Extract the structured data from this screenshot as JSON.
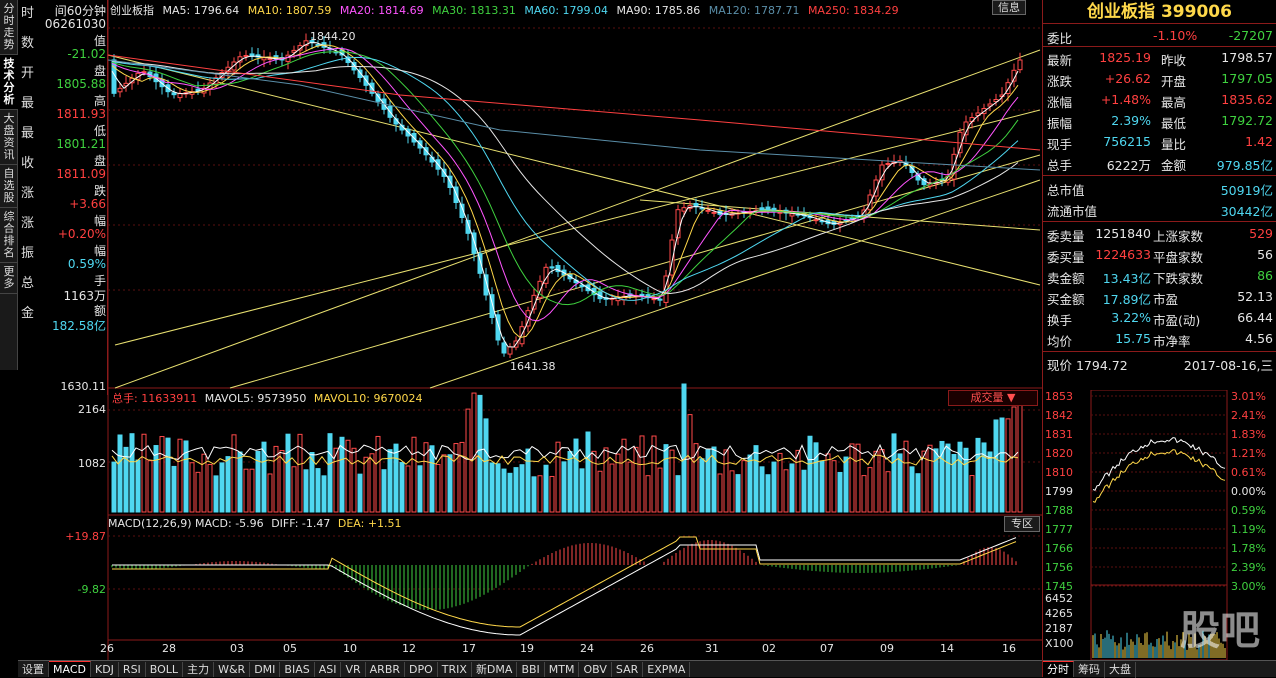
{
  "vertical_tabs": [
    "分时走势",
    "技术分析",
    "大盘资讯",
    "自选股",
    "综合排名",
    "更多"
  ],
  "left_info": {
    "items": [
      {
        "label": "时",
        "value": "间60分钟",
        "color": "white"
      },
      {
        "label": "",
        "value": "06261030",
        "color": "white"
      },
      {
        "label": "数",
        "value": "值",
        "color": "white"
      },
      {
        "label": "",
        "value": "-21.02",
        "color": "green"
      },
      {
        "label": "开",
        "value": "盘",
        "color": "white"
      },
      {
        "label": "",
        "value": "1805.88",
        "color": "green"
      },
      {
        "label": "最",
        "value": "高",
        "color": "white"
      },
      {
        "label": "",
        "value": "1811.93",
        "color": "red"
      },
      {
        "label": "最",
        "value": "低",
        "color": "white"
      },
      {
        "label": "",
        "value": "1801.21",
        "color": "green"
      },
      {
        "label": "收",
        "value": "盘",
        "color": "white"
      },
      {
        "label": "",
        "value": "1811.09",
        "color": "red"
      },
      {
        "label": "涨",
        "value": "跌",
        "color": "white"
      },
      {
        "label": "",
        "value": "+3.66",
        "color": "red"
      },
      {
        "label": "涨",
        "value": "幅",
        "color": "white"
      },
      {
        "label": "",
        "value": "+0.20%",
        "color": "red"
      },
      {
        "label": "振",
        "value": "幅",
        "color": "white"
      },
      {
        "label": "",
        "value": "0.59%",
        "color": "cyan"
      },
      {
        "label": "总",
        "value": "手",
        "color": "white"
      },
      {
        "label": "",
        "value": "1163万",
        "color": "white"
      },
      {
        "label": "金",
        "value": "额",
        "color": "white"
      },
      {
        "label": "",
        "value": "182.58亿",
        "color": "cyan"
      }
    ]
  },
  "ma_line": {
    "title": "创业板指",
    "ma5": "MA5: 1796.64",
    "ma10": "MA10: 1807.59",
    "ma20": "MA20: 1814.69",
    "ma30": "MA30: 1813.31",
    "ma60": "MA60: 1799.04",
    "ma90": "MA90: 1785.86",
    "ma120": "MA120: 1787.71",
    "ma250": "MA250: 1834.29"
  },
  "price_annotations": {
    "high": "1844.20",
    "low": "1641.38",
    "axis_bottom": "1630.11"
  },
  "volume": {
    "header": "总手: 11633911",
    "mavol5": "MAVOL5: 9573950",
    "mavol10": "MAVOL10: 9670024",
    "axis_top": "2164",
    "axis_mid": "1082",
    "dropdown": "成交量"
  },
  "macd": {
    "header": "MACD(12,26,9) MACD: -5.96",
    "diff": "DIFF: -1.47",
    "dea": "DEA: +1.51",
    "axis_top": "+19.87",
    "axis_bottom": "-9.82",
    "button": "专区"
  },
  "dates": [
    "26",
    "28",
    "03",
    "05",
    "10",
    "12",
    "17",
    "19",
    "24",
    "26",
    "31",
    "02",
    "07",
    "09",
    "14",
    "16"
  ],
  "info_button": "信息",
  "right_panel": {
    "title": "创业板指 399006",
    "weibi": {
      "label": "委比",
      "pct": "-1.10%",
      "value": "-27207"
    },
    "quote": [
      {
        "l1": "最新",
        "v1": "1825.19",
        "c1": "red",
        "l2": "昨收",
        "v2": "1798.57",
        "c2": "white"
      },
      {
        "l1": "涨跌",
        "v1": "+26.62",
        "c1": "red",
        "l2": "开盘",
        "v2": "1797.05",
        "c2": "green"
      },
      {
        "l1": "涨幅",
        "v1": "+1.48%",
        "c1": "red",
        "l2": "最高",
        "v2": "1835.62",
        "c2": "red"
      },
      {
        "l1": "振幅",
        "v1": "2.39%",
        "c1": "cyan",
        "l2": "最低",
        "v2": "1792.72",
        "c2": "green"
      },
      {
        "l1": "现手",
        "v1": "756215",
        "c1": "cyan",
        "l2": "量比",
        "v2": "1.42",
        "c2": "red"
      },
      {
        "l1": "总手",
        "v1": "6222万",
        "c1": "white",
        "l2": "金额",
        "v2": "979.85亿",
        "c2": "cyan"
      }
    ],
    "market": [
      {
        "l": "总市值",
        "v": "50919亿"
      },
      {
        "l": "流通市值",
        "v": "30442亿"
      }
    ],
    "stats": [
      {
        "l1": "委卖量",
        "v1": "1251840",
        "c1": "white",
        "l2": "上涨家数",
        "v2": "529",
        "c2": "red"
      },
      {
        "l1": "委买量",
        "v1": "1224633",
        "c1": "red",
        "l2": "平盘家数",
        "v2": "56",
        "c2": "white"
      },
      {
        "l1": "卖金额",
        "v1": "13.43亿",
        "c1": "cyan",
        "l2": "下跌家数",
        "v2": "86",
        "c2": "green"
      },
      {
        "l1": "买金额",
        "v1": "17.89亿",
        "c1": "cyan",
        "l2": "市盈",
        "v2": "52.13",
        "c2": "white"
      },
      {
        "l1": "换手",
        "v1": "3.22%",
        "c1": "cyan",
        "l2": "市盈(动)",
        "v2": "66.44",
        "c2": "white"
      },
      {
        "l1": "均价",
        "v1": "15.75",
        "c1": "cyan",
        "l2": "市净率",
        "v2": "4.56",
        "c2": "white"
      }
    ],
    "mini": {
      "header": "现价 1794.72",
      "date": "2017-08-16,三",
      "left_axis": [
        "1853",
        "1842",
        "1831",
        "1820",
        "1810",
        "1799",
        "1788",
        "1777",
        "1766",
        "1756",
        "1745"
      ],
      "right_axis": [
        "3.01%",
        "2.41%",
        "1.83%",
        "1.21%",
        "0.61%",
        "0.00%",
        "0.59%",
        "1.19%",
        "1.78%",
        "2.39%",
        "3.00%"
      ],
      "vol_axis": [
        "6452",
        "4265",
        "2187",
        "X100"
      ],
      "tabs": [
        "分时",
        "筹码",
        "大盘"
      ]
    }
  },
  "bottom_tabs": [
    "设置",
    "MACD",
    "KDJ",
    "RSI",
    "BOLL",
    "主力",
    "W&R",
    "DMI",
    "BIAS",
    "ASI",
    "VR",
    "ARBR",
    "DPO",
    "TRIX",
    "新DMA",
    "BBI",
    "MTM",
    "OBV",
    "SAR",
    "EXPMA"
  ],
  "watermark": "股吧"
}
